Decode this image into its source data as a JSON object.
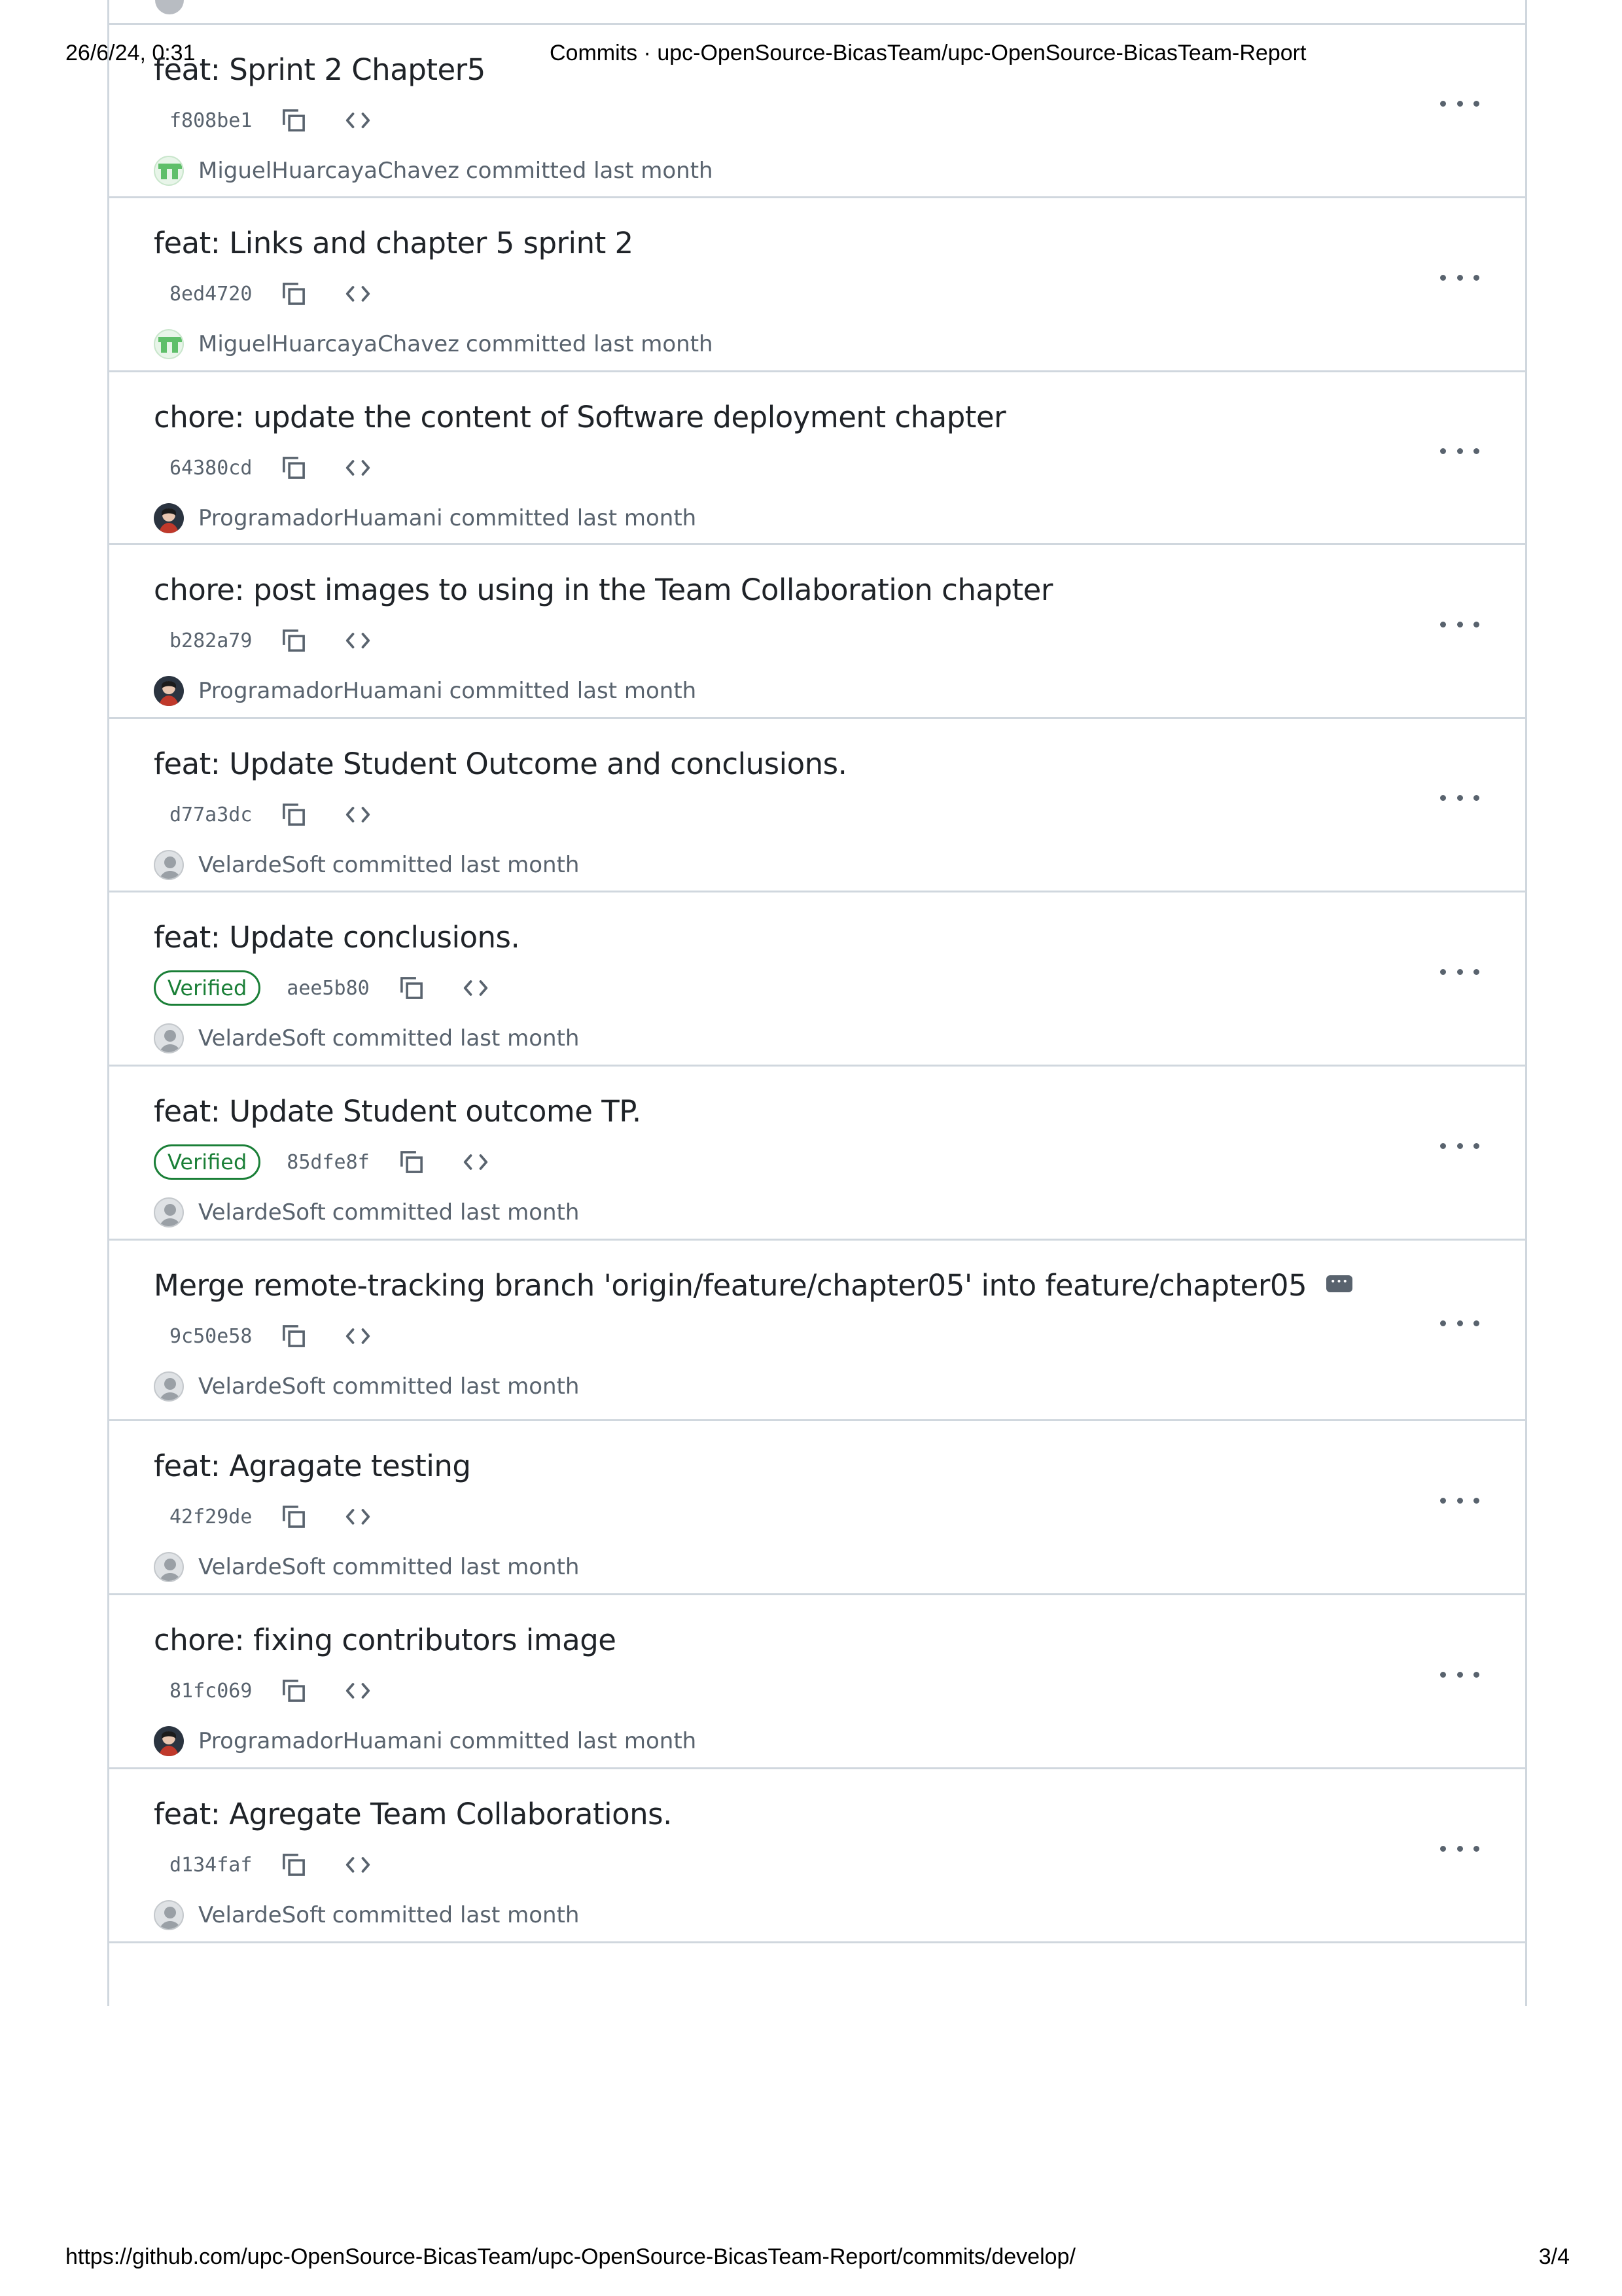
{
  "print_header": {
    "date": "26/6/24, 0:31",
    "title": "Commits · upc-OpenSource-BicasTeam/upc-OpenSource-BicasTeam-Report"
  },
  "print_footer": {
    "url": "https://github.com/upc-OpenSource-BicasTeam/upc-OpenSource-BicasTeam-Report/commits/develop/",
    "page": "3/4"
  },
  "commits": [
    {
      "title": "feat: Sprint 2 Chapter5",
      "sha": "f808be1",
      "verified": false,
      "author": "MiguelHuarcayaChavez",
      "suffix": "committed last month",
      "avatar": "green"
    },
    {
      "title": "feat: Links and chapter 5 sprint 2",
      "sha": "8ed4720",
      "verified": false,
      "author": "MiguelHuarcayaChavez",
      "suffix": "committed last month",
      "avatar": "green"
    },
    {
      "title": "chore: update the content of Software deployment chapter",
      "sha": "64380cd",
      "verified": false,
      "author": "ProgramadorHuamani",
      "suffix": "committed last month",
      "avatar": "dark"
    },
    {
      "title": "chore: post images to using in the Team Collaboration chapter",
      "sha": "b282a79",
      "verified": false,
      "author": "ProgramadorHuamani",
      "suffix": "committed last month",
      "avatar": "dark"
    },
    {
      "title": "feat: Update Student Outcome and conclusions.",
      "sha": "d77a3dc",
      "verified": false,
      "author": "VelardeSoft",
      "suffix": "committed last month",
      "avatar": "grey"
    },
    {
      "title": "feat: Update conclusions.",
      "sha": "aee5b80",
      "verified": true,
      "badge": "Verified",
      "author": "VelardeSoft",
      "suffix": "committed last month",
      "avatar": "grey"
    },
    {
      "title": "feat: Update Student outcome TP.",
      "sha": "85dfe8f",
      "verified": true,
      "badge": "Verified",
      "author": "VelardeSoft",
      "suffix": "committed last month",
      "avatar": "grey"
    },
    {
      "title": "Merge remote-tracking branch 'origin/feature/chapter05' into feature/chapter05",
      "sha": "9c50e58",
      "verified": false,
      "author": "VelardeSoft",
      "suffix": "committed last month",
      "avatar": "grey",
      "has_more_text": true
    },
    {
      "title": "feat: Agragate testing",
      "sha": "42f29de",
      "verified": false,
      "author": "VelardeSoft",
      "suffix": "committed last month",
      "avatar": "grey"
    },
    {
      "title": "chore: fixing contributors image",
      "sha": "81fc069",
      "verified": false,
      "author": "ProgramadorHuamani",
      "suffix": "committed last month",
      "avatar": "dark"
    },
    {
      "title": "feat: Agregate Team Collaborations.",
      "sha": "d134faf",
      "verified": false,
      "author": "VelardeSoft",
      "suffix": "committed last month",
      "avatar": "grey"
    }
  ],
  "icons": {
    "copy": "copy-icon",
    "browse": "code-icon",
    "more": "kebab-horizontal-icon"
  },
  "colors": {
    "verified": "#1a7f37",
    "border": "#d0d7de",
    "muted": "#59636e"
  }
}
